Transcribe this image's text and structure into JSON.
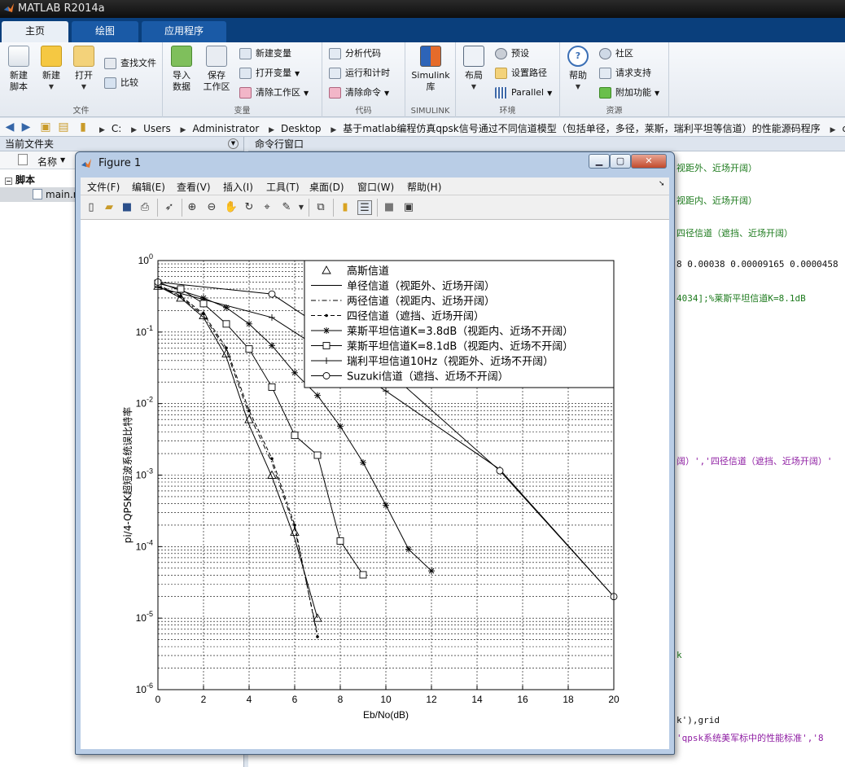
{
  "app": {
    "title": "MATLAB R2014a"
  },
  "tabs": [
    {
      "label": "主页"
    },
    {
      "label": "绘图"
    },
    {
      "label": "应用程序"
    }
  ],
  "ribbon": {
    "groups": {
      "file": "文件",
      "variable": "变量",
      "code": "代码",
      "simulink": "SIMULINK",
      "env": "环境",
      "resources": "资源"
    },
    "new_script": "新建\n脚本",
    "new": "新建",
    "open": "打开",
    "find_files": "查找文件",
    "compare": "比较",
    "import": "导入\n数据",
    "save_ws": "保存\n工作区",
    "new_var": "新建变量",
    "open_var": "打开变量",
    "clear_ws": "清除工作区",
    "analyze": "分析代码",
    "run_time": "运行和计时",
    "clear_cmd": "清除命令",
    "simulink": "Simulink\n库",
    "layout": "布局",
    "prefs": "预设",
    "set_path": "设置路径",
    "parallel": "Parallel",
    "help": "帮助",
    "community": "社区",
    "support": "请求支持",
    "addons": "附加功能"
  },
  "address": {
    "crumbs": [
      "C:",
      "Users",
      "Administrator",
      "Desktop",
      "基于matlab编程仿真qpsk信号通过不同信道模型（包括单径，多径，莱斯，瑞利平坦等信道）的性能源码程序",
      "code"
    ]
  },
  "folder_panel": {
    "title": "当前文件夹",
    "col_name": "名称",
    "group": "脚本",
    "file": "main.m"
  },
  "command_window": {
    "title": "命令行窗口",
    "lines": [
      "视距外、近场开阔）",
      "视距内、近场开阔）",
      "四径信道（遮挡、近场开阔）",
      "8 0.00038 0.00009165 0.0000458",
      "4034];%莱斯平坦信道K=8.1dB",
      "阔）','四径信道（遮挡、近场开阔）'",
      "k",
      "k'),grid",
      "'qpsk系统美军标中的性能标准','8"
    ]
  },
  "figure": {
    "title": "Figure 1",
    "menu": [
      "文件(F)",
      "编辑(E)",
      "查看(V)",
      "插入(I)",
      "工具(T)",
      "桌面(D)",
      "窗口(W)",
      "帮助(H)"
    ]
  },
  "chart_data": {
    "type": "line",
    "title": "",
    "xlabel": "Eb/No(dB)",
    "ylabel": "pi/4-QPSK超短波系统误比特率",
    "xlim": [
      0,
      20
    ],
    "ylim": [
      1e-06,
      1
    ],
    "yscale": "log",
    "grid": true,
    "legend_position": "top-right",
    "x_ticks": [
      0,
      2,
      4,
      6,
      8,
      10,
      12,
      14,
      16,
      18,
      20
    ],
    "y_ticks": [
      "10^0",
      "10^-1",
      "10^-2",
      "10^-3",
      "10^-4",
      "10^-5",
      "10^-6"
    ],
    "series": [
      {
        "name": "高斯信道",
        "marker": "triangle",
        "line": "none",
        "x": [
          0,
          1,
          2,
          3,
          4,
          5,
          6,
          7
        ],
        "y": [
          0.44,
          0.3,
          0.17,
          0.05,
          0.006,
          0.001,
          0.00016,
          1e-05
        ]
      },
      {
        "name": "单径信道（视距外、近场开阔）",
        "marker": "none",
        "line": "solid",
        "x": [
          0,
          1,
          2,
          3,
          4,
          5,
          6,
          7
        ],
        "y": [
          0.44,
          0.3,
          0.16,
          0.045,
          0.005,
          0.00095,
          0.00013,
          1e-05
        ]
      },
      {
        "name": "两径信道（视距内、近场开阔）",
        "marker": "none",
        "line": "dashdot",
        "x": [
          0,
          1,
          2,
          3,
          4,
          5,
          6,
          7
        ],
        "y": [
          0.45,
          0.31,
          0.17,
          0.055,
          0.007,
          0.0015,
          0.00018,
          6e-06
        ]
      },
      {
        "name": "四径信道（遮挡、近场开阔）",
        "marker": "dot",
        "line": "dashed",
        "x": [
          0,
          1,
          2,
          3,
          4,
          5,
          6,
          7
        ],
        "y": [
          0.46,
          0.32,
          0.18,
          0.06,
          0.008,
          0.0017,
          0.0002,
          5.5e-06
        ]
      },
      {
        "name": "莱斯平坦信道K=3.8dB（视距内、近场不开阔）",
        "marker": "star",
        "line": "solid",
        "x": [
          0,
          1,
          2,
          3,
          4,
          5,
          6,
          7,
          8,
          9,
          10,
          11,
          12
        ],
        "y": [
          0.5,
          0.38,
          0.3,
          0.22,
          0.13,
          0.065,
          0.027,
          0.013,
          0.0048,
          0.0015,
          0.00038,
          9.165e-05,
          4.58e-05
        ]
      },
      {
        "name": "莱斯平坦信道K=8.1dB（视距内、近场不开阔）",
        "marker": "square",
        "line": "solid",
        "x": [
          0,
          1,
          2,
          3,
          4,
          5,
          6,
          7,
          8,
          9
        ],
        "y": [
          0.48,
          0.4,
          0.25,
          0.13,
          0.058,
          0.017,
          0.0036,
          0.0019,
          0.00012,
          4.034e-05
        ]
      },
      {
        "name": "瑞利平坦信道10Hz（视距外、近场不开阔）",
        "marker": "plus",
        "line": "solid",
        "x": [
          0,
          5,
          10,
          15,
          20
        ],
        "y": [
          0.42,
          0.16,
          0.015,
          0.0012,
          2e-05
        ]
      },
      {
        "name": "Suzuki信道（遮挡、近场不开阔）",
        "marker": "circle",
        "line": "solid",
        "x": [
          0,
          5,
          10,
          15,
          20
        ],
        "y": [
          0.5,
          0.34,
          0.03,
          0.00115,
          2e-05
        ]
      }
    ]
  }
}
